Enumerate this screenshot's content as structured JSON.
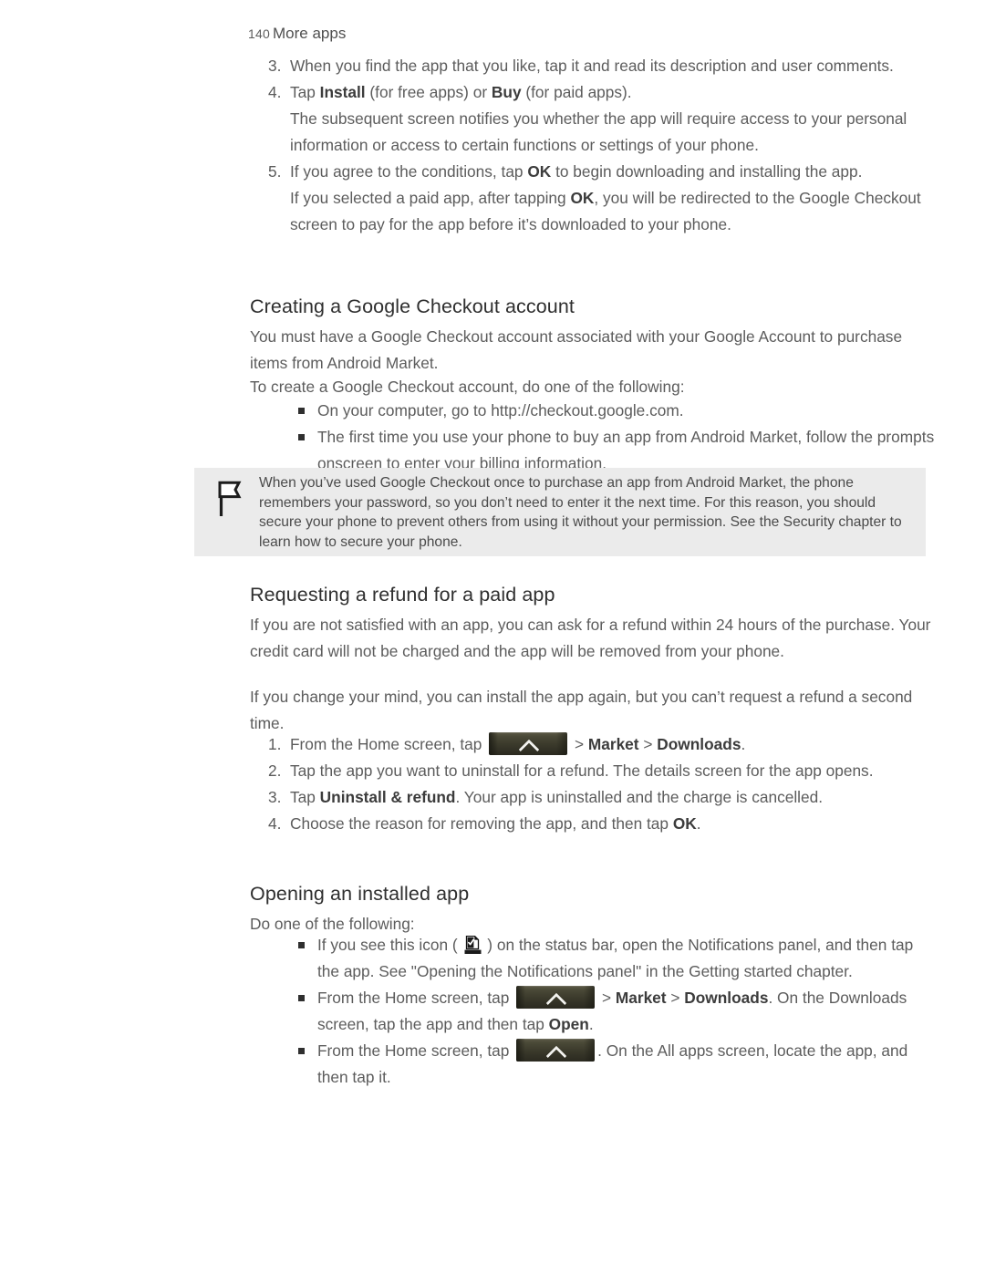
{
  "page": {
    "number": "140",
    "chapter": "More apps"
  },
  "icons": {
    "note_flag": "flag-icon",
    "home_button": "home-apps-button-icon",
    "install_notification": "app-installed-notification-icon"
  },
  "steps_top": {
    "items": [
      {
        "num": "3.",
        "text": "When you find the app that you like, tap it and read its description and user comments."
      },
      {
        "num": "4.",
        "text_parts": [
          {
            "t": "Tap ",
            "bold": false
          },
          {
            "t": "Install",
            "bold": true
          },
          {
            "t": " (for free apps) or ",
            "bold": false
          },
          {
            "t": "Buy",
            "bold": true
          },
          {
            "t": " (for paid apps).",
            "bold": false
          }
        ],
        "continuation": "The subsequent screen notifies you whether the app will require access to your personal information or access to certain functions or settings of your phone."
      },
      {
        "num": "5.",
        "text_parts": [
          {
            "t": "If you agree to the conditions, tap ",
            "bold": false
          },
          {
            "t": "OK",
            "bold": true
          },
          {
            "t": " to begin downloading and installing the app.",
            "bold": false
          }
        ],
        "continuation_parts": [
          {
            "t": "If you selected a paid app, after tapping ",
            "bold": false
          },
          {
            "t": "OK",
            "bold": true
          },
          {
            "t": ", you will be redirected to the Google Checkout screen to pay for the app before it’s downloaded to your phone.",
            "bold": false
          }
        ]
      }
    ]
  },
  "section_checkout": {
    "heading": "Creating a Google Checkout account",
    "para1": "You must have a Google Checkout account associated with your Google Account to purchase items from Android Market.",
    "para2": "To create a Google Checkout account, do one of the following:",
    "bullets": [
      "On your computer, go to http://checkout.google.com.",
      "The first time you use your phone to buy an app from Android Market, follow the prompts onscreen to enter your billing information."
    ]
  },
  "note": {
    "text": "When you’ve used Google Checkout once to purchase an app from Android Market, the phone remembers your password, so you don’t need to enter it the next time. For this reason, you should secure your phone to prevent others from using it without your permission. See the Security chapter to learn how to secure your phone.",
    "background": "#ebebeb"
  },
  "section_refund": {
    "heading": "Requesting a refund for a paid app",
    "para1": "If you are not satisfied with an app, you can ask for a refund within 24 hours of the purchase. Your credit card will not be charged and the app will be removed from your phone.",
    "para2": "If you change your mind, you can install the app again, but you can’t request a refund a second time.",
    "steps": [
      {
        "num": "1.",
        "parts": [
          {
            "t": "From the Home screen, tap ",
            "bold": false
          },
          {
            "t": "[home-button]",
            "icon": "home_button"
          },
          {
            "t": " > ",
            "bold": false
          },
          {
            "t": "Market",
            "bold": true
          },
          {
            "t": " > ",
            "bold": false
          },
          {
            "t": "Downloads",
            "bold": true
          },
          {
            "t": ".",
            "bold": false
          }
        ]
      },
      {
        "num": "2.",
        "parts": [
          {
            "t": "Tap the app you want to uninstall for a refund. The details screen for the app opens.",
            "bold": false
          }
        ]
      },
      {
        "num": "3.",
        "parts": [
          {
            "t": "Tap ",
            "bold": false
          },
          {
            "t": "Uninstall & refund",
            "bold": true
          },
          {
            "t": ". Your app is uninstalled and the charge is cancelled.",
            "bold": false
          }
        ]
      },
      {
        "num": "4.",
        "parts": [
          {
            "t": "Choose the reason for removing the app, and then tap ",
            "bold": false
          },
          {
            "t": "OK",
            "bold": true
          },
          {
            "t": ".",
            "bold": false
          }
        ]
      }
    ]
  },
  "section_opening": {
    "heading": "Opening an installed app",
    "para1": "Do one of the following:",
    "bullets": [
      {
        "parts": [
          {
            "t": "If you see this icon ( ",
            "bold": false
          },
          {
            "t": "[install-icon]",
            "icon": "install_notification"
          },
          {
            "t": " ) on the status bar, open the Notifications panel, and then tap the app. See \"Opening the Notifications panel\" in the Getting started chapter.",
            "bold": false
          }
        ]
      },
      {
        "parts": [
          {
            "t": "From the Home screen, tap ",
            "bold": false
          },
          {
            "t": "[home-button]",
            "icon": "home_button"
          },
          {
            "t": " > ",
            "bold": false
          },
          {
            "t": "Market",
            "bold": true
          },
          {
            "t": " > ",
            "bold": false
          },
          {
            "t": "Downloads",
            "bold": true
          },
          {
            "t": ". On the Downloads screen, tap the app and then tap ",
            "bold": false
          },
          {
            "t": "Open",
            "bold": true
          },
          {
            "t": ".",
            "bold": false
          }
        ]
      },
      {
        "parts": [
          {
            "t": "From the Home screen, tap ",
            "bold": false
          },
          {
            "t": "[home-button]",
            "icon": "home_button"
          },
          {
            "t": ". On the All apps screen, locate the app, and then tap it.",
            "bold": false
          }
        ]
      }
    ]
  }
}
